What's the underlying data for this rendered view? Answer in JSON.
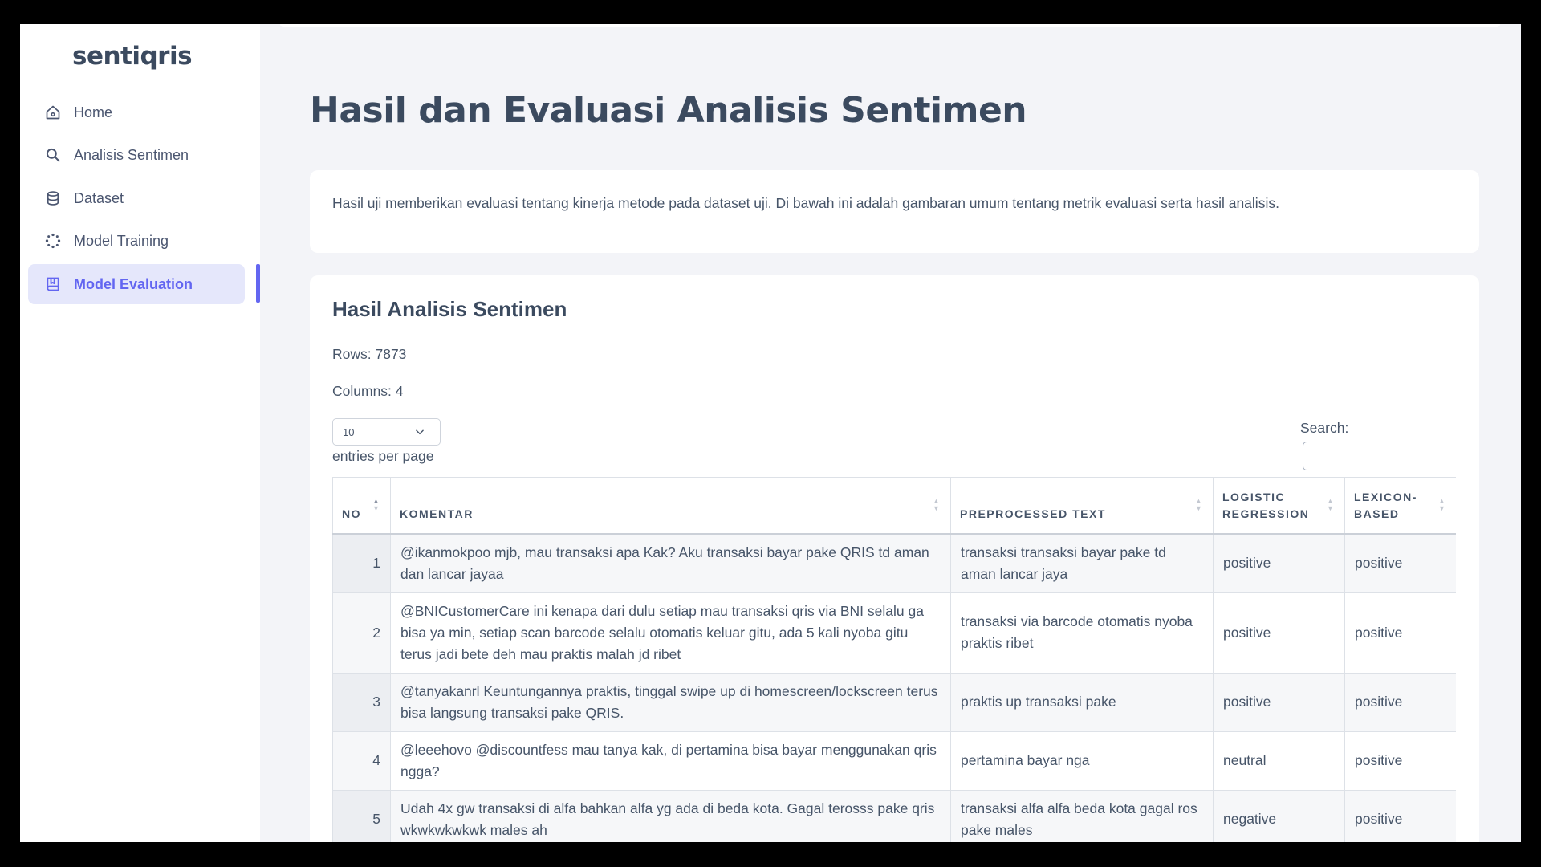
{
  "app": {
    "brand": "sentiqris"
  },
  "sidebar": {
    "items": [
      {
        "label": "Home",
        "icon": "home-icon",
        "active": false
      },
      {
        "label": "Analisis Sentimen",
        "icon": "search-icon",
        "active": false
      },
      {
        "label": "Dataset",
        "icon": "database-icon",
        "active": false
      },
      {
        "label": "Model Training",
        "icon": "loader-icon",
        "active": false
      },
      {
        "label": "Model Evaluation",
        "icon": "book-icon",
        "active": true
      }
    ]
  },
  "main": {
    "title": "Hasil dan Evaluasi Analisis Sentimen",
    "intro": "Hasil uji memberikan evaluasi tentang kinerja metode pada dataset uji. Di bawah ini adalah gambaran umum tentang metrik evaluasi serta hasil analisis.",
    "results": {
      "title": "Hasil Analisis Sentimen",
      "rows_text": "Rows: 7873",
      "columns_text": "Columns: 4",
      "entries_value": "10",
      "entries_label": "entries per page",
      "search_label": "Search:",
      "search_value": "",
      "headers": [
        "NO",
        "KOMENTAR",
        "PREPROCESSED TEXT",
        "LOGISTIC REGRESSION",
        "LEXICON-BASED"
      ],
      "rows": [
        [
          "1",
          "@ikanmokpoo mjb, mau transaksi apa Kak? Aku transaksi bayar pake QRIS td aman dan lancar jayaa",
          "transaksi transaksi bayar pake td aman lancar jaya",
          "positive",
          "positive"
        ],
        [
          "2",
          "@BNICustomerCare ini kenapa dari dulu setiap mau transaksi qris via BNI selalu ga bisa ya min, setiap scan barcode selalu otomatis keluar gitu, ada 5 kali nyoba gitu terus jadi bete deh mau praktis malah jd ribet",
          "transaksi via barcode otomatis nyoba praktis ribet",
          "positive",
          "positive"
        ],
        [
          "3",
          "@tanyakanrl Keuntungannya praktis, tinggal swipe up di homescreen/lockscreen terus bisa langsung transaksi pake QRIS.",
          "praktis up transaksi pake",
          "positive",
          "positive"
        ],
        [
          "4",
          "@leeehovo @discountfess mau tanya kak, di pertamina bisa bayar menggunakan qris ngga?",
          "pertamina bayar nga",
          "neutral",
          "positive"
        ],
        [
          "5",
          "Udah 4x gw transaksi di alfa bahkan alfa yg ada di beda kota. Gagal terosss pake qris wkwkwkwkwk males ah",
          "transaksi alfa alfa beda kota gagal ros pake males",
          "negative",
          "positive"
        ]
      ]
    }
  }
}
